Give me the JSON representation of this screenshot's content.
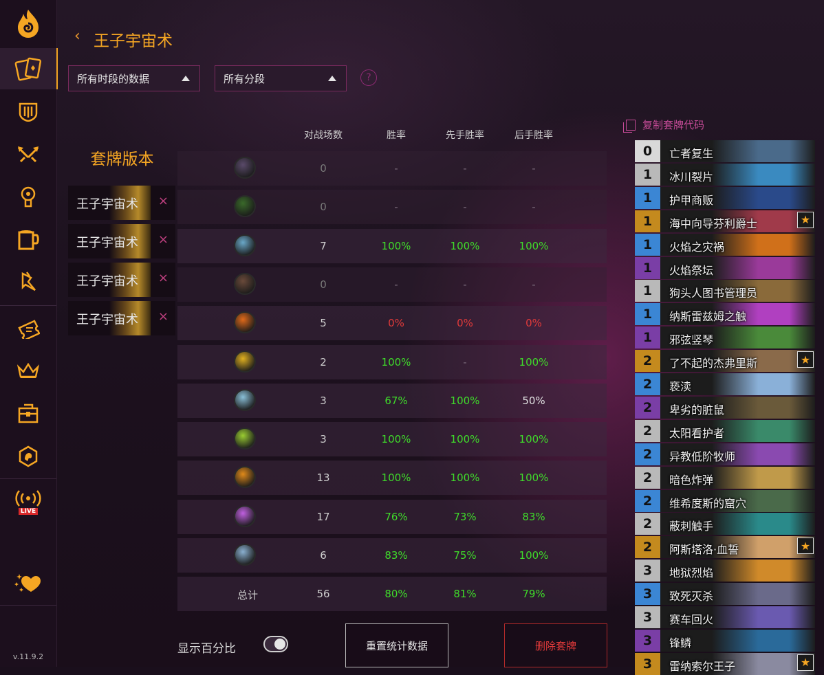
{
  "app": {
    "version": "v.11.9.2"
  },
  "sidebar": {
    "items": [
      {
        "name": "flame-logo-icon"
      },
      {
        "name": "decks-icon"
      },
      {
        "name": "arena-icon"
      },
      {
        "name": "battlegrounds-icon"
      },
      {
        "name": "mercenaries-icon"
      },
      {
        "name": "tavern-icon"
      },
      {
        "name": "duels-icon"
      },
      {
        "name": "tickets-icon"
      },
      {
        "name": "crown-icon"
      },
      {
        "name": "chest-icon"
      },
      {
        "name": "achievements-icon"
      },
      {
        "name": "live-icon",
        "label": "LIVE"
      },
      {
        "name": "support-heart-icon"
      }
    ]
  },
  "header": {
    "title": "王子宇宙术",
    "back": "‹",
    "filter_time": "所有时段的数据",
    "filter_rank": "所有分段",
    "help": "?"
  },
  "versions": {
    "title": "套牌版本",
    "items": [
      {
        "name": "王子宇宙术",
        "remove": "×"
      },
      {
        "name": "王子宇宙术",
        "remove": "×"
      },
      {
        "name": "王子宇宙术",
        "remove": "×"
      },
      {
        "name": "王子宇宙术",
        "remove": "×"
      }
    ]
  },
  "stats": {
    "headers": [
      "对战场数",
      "胜率",
      "先手胜率",
      "后手胜率"
    ],
    "rows": [
      {
        "class": "demon-hunter",
        "color": "#5a4a6a",
        "games": "0",
        "wr": "-",
        "first": "-",
        "second": "-",
        "wr_c": "muted",
        "first_c": "muted",
        "second_c": "muted"
      },
      {
        "class": "druid",
        "color": "#3a6a2a",
        "games": "0",
        "wr": "-",
        "first": "-",
        "second": "-",
        "wr_c": "muted",
        "first_c": "muted",
        "second_c": "muted"
      },
      {
        "class": "hunter",
        "color": "#6aa8c8",
        "games": "7",
        "wr": "100%",
        "first": "100%",
        "second": "100%",
        "wr_c": "green",
        "first_c": "green",
        "second_c": "green"
      },
      {
        "class": "death-knight",
        "color": "#6a4a3a",
        "games": "0",
        "wr": "-",
        "first": "-",
        "second": "-",
        "wr_c": "muted",
        "first_c": "muted",
        "second_c": "muted"
      },
      {
        "class": "mage",
        "color": "#e06a1a",
        "games": "5",
        "wr": "0%",
        "first": "0%",
        "second": "0%",
        "wr_c": "red",
        "first_c": "red",
        "second_c": "red"
      },
      {
        "class": "paladin",
        "color": "#e0b020",
        "games": "2",
        "wr": "100%",
        "first": "-",
        "second": "100%",
        "wr_c": "green",
        "first_c": "muted",
        "second_c": "green"
      },
      {
        "class": "priest",
        "color": "#8ac0d8",
        "games": "3",
        "wr": "67%",
        "first": "100%",
        "second": "50%",
        "wr_c": "green",
        "first_c": "green",
        "second_c": "white"
      },
      {
        "class": "rogue",
        "color": "#9acd32",
        "games": "3",
        "wr": "100%",
        "first": "100%",
        "second": "100%",
        "wr_c": "green",
        "first_c": "green",
        "second_c": "green"
      },
      {
        "class": "shaman",
        "color": "#e08a1a",
        "games": "13",
        "wr": "100%",
        "first": "100%",
        "second": "100%",
        "wr_c": "green",
        "first_c": "green",
        "second_c": "green"
      },
      {
        "class": "warlock",
        "color": "#c060e0",
        "games": "17",
        "wr": "76%",
        "first": "73%",
        "second": "83%",
        "wr_c": "green",
        "first_c": "green",
        "second_c": "green"
      },
      {
        "class": "warrior",
        "color": "#8ab0d0",
        "games": "6",
        "wr": "83%",
        "first": "75%",
        "second": "100%",
        "wr_c": "green",
        "first_c": "green",
        "second_c": "green"
      }
    ],
    "total": {
      "label": "总计",
      "games": "56",
      "wr": "80%",
      "first": "81%",
      "second": "79%"
    }
  },
  "controls": {
    "show_percent_label": "显示百分比",
    "show_percent_on": true,
    "reset_button": "重置统计数据",
    "delete_button": "删除套牌"
  },
  "cardlist": {
    "copy_label": "复制套牌代码",
    "cards": [
      {
        "cost": "0",
        "name": "亡者复生",
        "rarity": "0",
        "art": "#4a6a8a",
        "legendary": false
      },
      {
        "cost": "1",
        "name": "冰川裂片",
        "rarity": "2",
        "art": "#3a8ac0",
        "legendary": false
      },
      {
        "cost": "1",
        "name": "护甲商贩",
        "rarity": "1",
        "art": "#2a4a8a",
        "legendary": false
      },
      {
        "cost": "1",
        "name": "海中向导芬利爵士",
        "rarity": "4",
        "art": "#a03a4a",
        "legendary": true
      },
      {
        "cost": "1",
        "name": "火焰之灾祸",
        "rarity": "1",
        "art": "#d0701a",
        "legendary": false
      },
      {
        "cost": "1",
        "name": "火焰祭坛",
        "rarity": "3",
        "art": "#9a3a9a",
        "legendary": false
      },
      {
        "cost": "1",
        "name": "狗头人图书管理员",
        "rarity": "2",
        "art": "#8a6a3a",
        "legendary": false
      },
      {
        "cost": "1",
        "name": "纳斯雷兹姆之触",
        "rarity": "1",
        "art": "#b040c0",
        "legendary": false
      },
      {
        "cost": "1",
        "name": "邪弦竖琴",
        "rarity": "3",
        "art": "#4a8a3a",
        "legendary": false
      },
      {
        "cost": "2",
        "name": "了不起的杰弗里斯",
        "rarity": "4",
        "art": "#8a6a4a",
        "legendary": true
      },
      {
        "cost": "2",
        "name": "亵渎",
        "rarity": "1",
        "art": "#8ab0d8",
        "legendary": false
      },
      {
        "cost": "2",
        "name": "卑劣的脏鼠",
        "rarity": "3",
        "art": "#6a5a3a",
        "legendary": false
      },
      {
        "cost": "2",
        "name": "太阳看护者",
        "rarity": "2",
        "art": "#3a8a6a",
        "legendary": false
      },
      {
        "cost": "2",
        "name": "异教低阶牧师",
        "rarity": "1",
        "art": "#8a4ab0",
        "legendary": false
      },
      {
        "cost": "2",
        "name": "暗色炸弹",
        "rarity": "2",
        "art": "#c09a4a",
        "legendary": false
      },
      {
        "cost": "2",
        "name": "维希度斯的窟穴",
        "rarity": "1",
        "art": "#4a6a4a",
        "legendary": false
      },
      {
        "cost": "2",
        "name": "蔽刺触手",
        "rarity": "2",
        "art": "#2a8a8a",
        "legendary": false
      },
      {
        "cost": "2",
        "name": "阿斯塔洛·血誓",
        "rarity": "4",
        "art": "#d0a06a",
        "legendary": true
      },
      {
        "cost": "3",
        "name": "地狱烈焰",
        "rarity": "2",
        "art": "#d08a2a",
        "legendary": false
      },
      {
        "cost": "3",
        "name": "致死灭杀",
        "rarity": "1",
        "art": "#6a6a8a",
        "legendary": false
      },
      {
        "cost": "3",
        "name": "赛车回火",
        "rarity": "2",
        "art": "#6a5ab0",
        "legendary": false
      },
      {
        "cost": "3",
        "name": "锋鳞",
        "rarity": "3",
        "art": "#2a6a9a",
        "legendary": false
      },
      {
        "cost": "3",
        "name": "雷纳索尔王子",
        "rarity": "4",
        "art": "#8a8aa0",
        "legendary": true
      }
    ]
  }
}
